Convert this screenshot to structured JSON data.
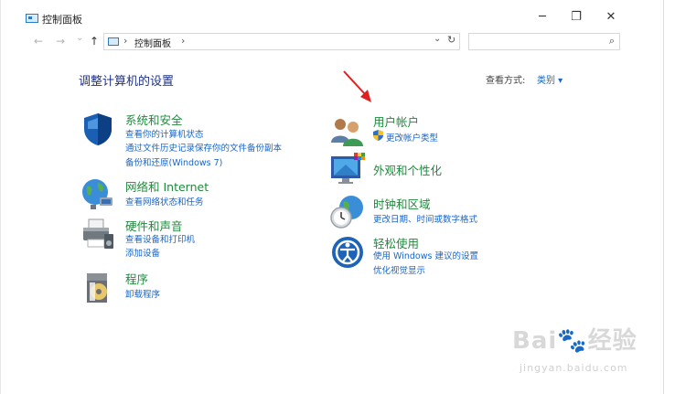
{
  "window": {
    "title": "控制面板",
    "minimize": "─",
    "maximize": "❐",
    "close": "✕"
  },
  "nav": {
    "back": "←",
    "forward": "→",
    "recent": "⌄",
    "up": "↑",
    "breadcrumb_sep": "›",
    "breadcrumb": "控制面板",
    "dropdown": "⌄",
    "refresh": "↻",
    "search_icon": "⌕",
    "search_placeholder": ""
  },
  "heading": "调整计算机的设置",
  "view_by": {
    "label": "查看方式:",
    "value": "类别 ▾"
  },
  "categories_left": [
    {
      "title": "系统和安全",
      "icon": "shield-icon",
      "links": [
        "查看你的计算机状态",
        "通过文件历史记录保存你的文件备份副本",
        "备份和还原(Windows 7)"
      ]
    },
    {
      "title": "网络和 Internet",
      "icon": "globe-network-icon",
      "links": [
        "查看网络状态和任务"
      ]
    },
    {
      "title": "硬件和声音",
      "icon": "printer-icon",
      "links": [
        "查看设备和打印机",
        "添加设备"
      ]
    },
    {
      "title": "程序",
      "icon": "program-disc-icon",
      "links": [
        "卸载程序"
      ]
    }
  ],
  "categories_right": [
    {
      "title": "用户帐户",
      "icon": "users-icon",
      "links": [
        "更改帐户类型"
      ]
    },
    {
      "title": "外观和个性化",
      "icon": "monitor-palette-icon",
      "links": []
    },
    {
      "title": "时钟和区域",
      "icon": "clock-globe-icon",
      "links": [
        "更改日期、时间或数字格式"
      ]
    },
    {
      "title": "轻松使用",
      "icon": "ease-of-access-icon",
      "links": [
        "使用 Windows 建议的设置",
        "优化视觉显示"
      ]
    }
  ],
  "watermark": {
    "main": "Bai🐾经验",
    "sub": "jingyan.baidu.com"
  },
  "colors": {
    "accent": "#1a65c8",
    "category_title": "#1e8a3c",
    "heading": "#1e3287",
    "arrow": "#e02020"
  }
}
